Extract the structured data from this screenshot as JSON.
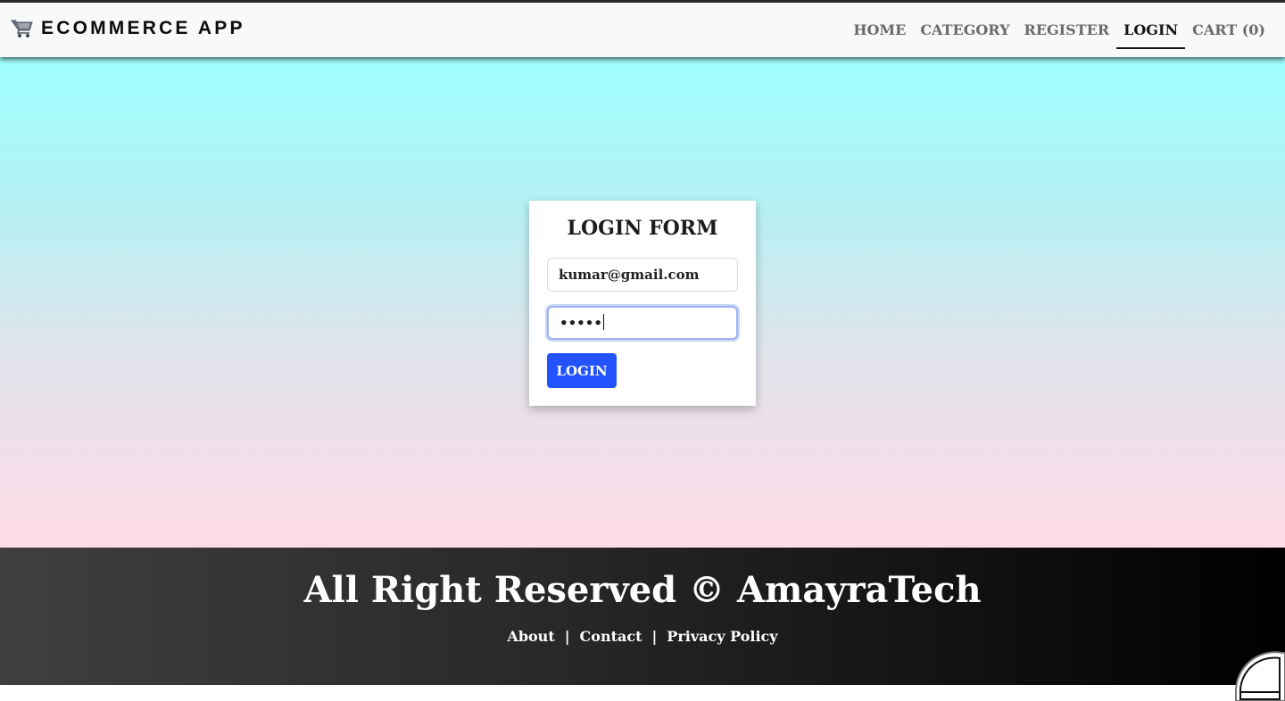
{
  "navbar": {
    "brand": "ECOMMERCE APP",
    "brand_icon": "shopping-cart-icon",
    "links": [
      {
        "label": "HOME"
      },
      {
        "label": "CATEGORY"
      },
      {
        "label": "REGISTER"
      },
      {
        "label": "LOGIN",
        "active": true
      },
      {
        "label": "CART (0)"
      }
    ]
  },
  "login_form": {
    "title": "LOGIN FORM",
    "email_value": "kumar@gmail.com",
    "password_masked": "•••••",
    "submit_label": "LOGIN"
  },
  "footer": {
    "copyright": "All Right Reserved © AmayraTech",
    "links": [
      "About",
      "Contact",
      "Privacy Policy"
    ],
    "separator": "|"
  },
  "colors": {
    "accent_button": "#2253ff",
    "background_top": "#a0ffff",
    "background_bottom": "#ffdbe8",
    "footer_dark": "#000000"
  }
}
